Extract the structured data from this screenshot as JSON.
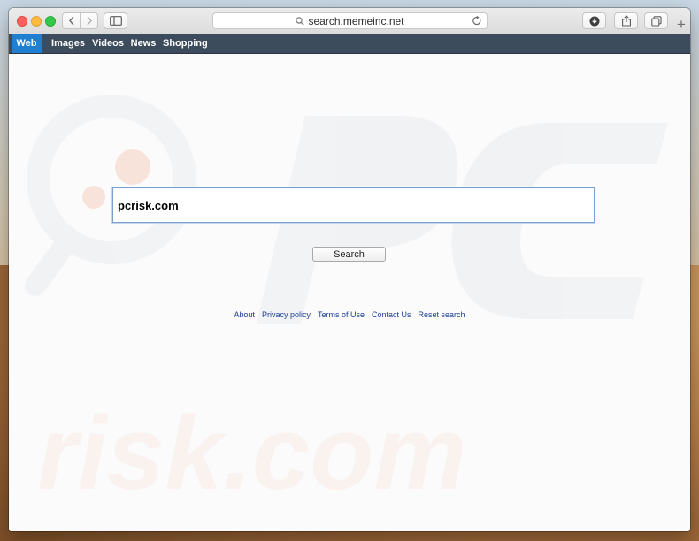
{
  "browser": {
    "address": "search.memeinc.net",
    "new_tab_symbol": "+",
    "icons": [
      "back-icon",
      "forward-icon",
      "sidebar-icon",
      "magnifier-icon",
      "reload-icon",
      "download-icon",
      "share-icon",
      "tabs-icon"
    ]
  },
  "nav": {
    "tabs": [
      {
        "label": "Web",
        "active": true
      },
      {
        "label": "Images",
        "active": false
      },
      {
        "label": "Videos",
        "active": false
      },
      {
        "label": "News",
        "active": false
      },
      {
        "label": "Shopping",
        "active": false
      }
    ]
  },
  "search": {
    "value": "pcrisk.com",
    "button_label": "Search"
  },
  "footer": {
    "links": [
      "About",
      "Privacy policy",
      "Terms of Use",
      "Contact Us",
      "Reset search"
    ]
  },
  "watermark": {
    "text": "risk.com"
  },
  "colors": {
    "nav_bar": "#3c4c5c",
    "active_tab": "#1f7fd0",
    "link": "#1a3f96"
  }
}
